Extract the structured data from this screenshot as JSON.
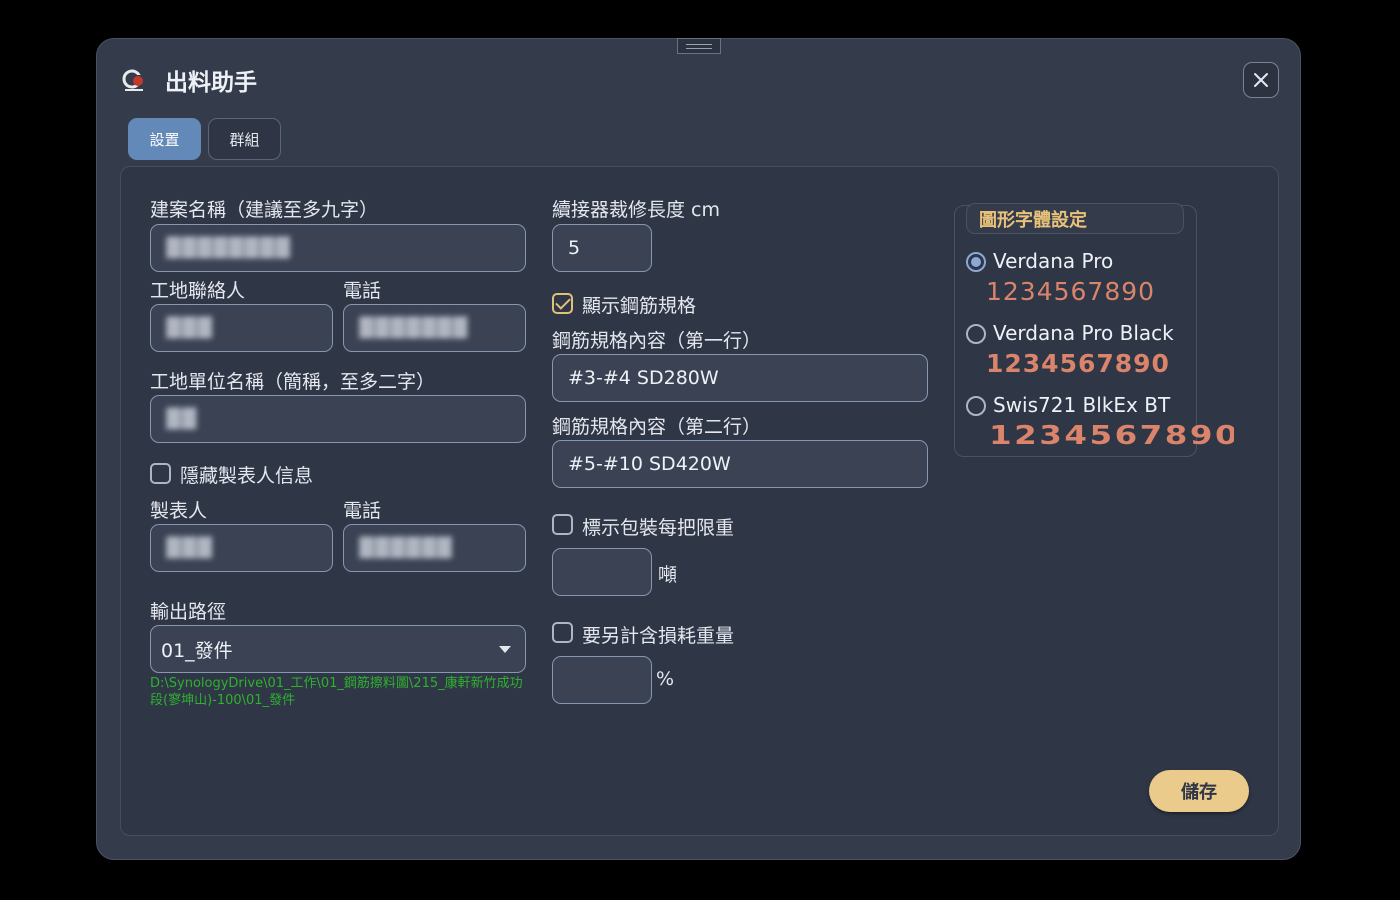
{
  "window": {
    "title": "出料助手"
  },
  "tabs": [
    {
      "label": "設置",
      "active": true
    },
    {
      "label": "群組",
      "active": false
    }
  ],
  "form": {
    "project_name_label": "建案名稱（建議至多九字）",
    "project_name_value": "▓▓▓▓▓▓▓▓",
    "site_contact_label": "工地聯絡人",
    "site_contact_value": "▓▓▓",
    "site_phone_label": "電話",
    "site_phone_value": "▓▓▓▓▓▓▓",
    "site_unit_label": "工地單位名稱（簡稱，至多二字）",
    "site_unit_value": "▓▓",
    "hide_maker_label": "隱藏製表人信息",
    "hide_maker_checked": false,
    "maker_label": "製表人",
    "maker_value": "▓▓▓",
    "maker_phone_label": "電話",
    "maker_phone_value": "▓▓▓▓▓▓",
    "output_path_label": "輸出路徑",
    "output_path_value": "01_發件",
    "output_path_full": "D:\\SynologyDrive\\01_工作\\01_鋼筋擦料圖\\215_康軒新竹成功段(寥坤山)-100\\01_發件",
    "coupler_label": "續接器裁修長度 cm",
    "coupler_value": "5",
    "show_spec_label": "顯示鋼筋規格",
    "show_spec_checked": true,
    "spec_line1_label": "鋼筋規格內容（第一行）",
    "spec_line1_value": "#3-#4 SD280W",
    "spec_line2_label": "鋼筋規格內容（第二行）",
    "spec_line2_value": "#5-#10 SD420W",
    "pack_weight_label": "標示包裝每把限重",
    "pack_weight_checked": false,
    "pack_weight_value": "",
    "pack_weight_unit": "噸",
    "loss_weight_label": "要另計含損耗重量",
    "loss_weight_checked": false,
    "loss_weight_value": "",
    "loss_weight_unit": "%"
  },
  "font_settings": {
    "title": "圖形字體設定",
    "options": [
      {
        "name": "Verdana Pro",
        "sample": "1234567890",
        "selected": true
      },
      {
        "name": "Verdana Pro Black",
        "sample": "1234567890",
        "selected": false
      },
      {
        "name": "Swis721 BlkEx BT",
        "sample": "1234567890",
        "selected": false
      }
    ]
  },
  "actions": {
    "save_label": "儲存"
  },
  "colors": {
    "accent_gold": "#eacb8c",
    "tab_active": "#6389b8",
    "path_green": "#2fb12f",
    "sample_orange": "#d9846b"
  },
  "icons": {
    "close": "close-icon",
    "logo": "app-logo-icon",
    "dropdown": "chevron-down-icon"
  }
}
